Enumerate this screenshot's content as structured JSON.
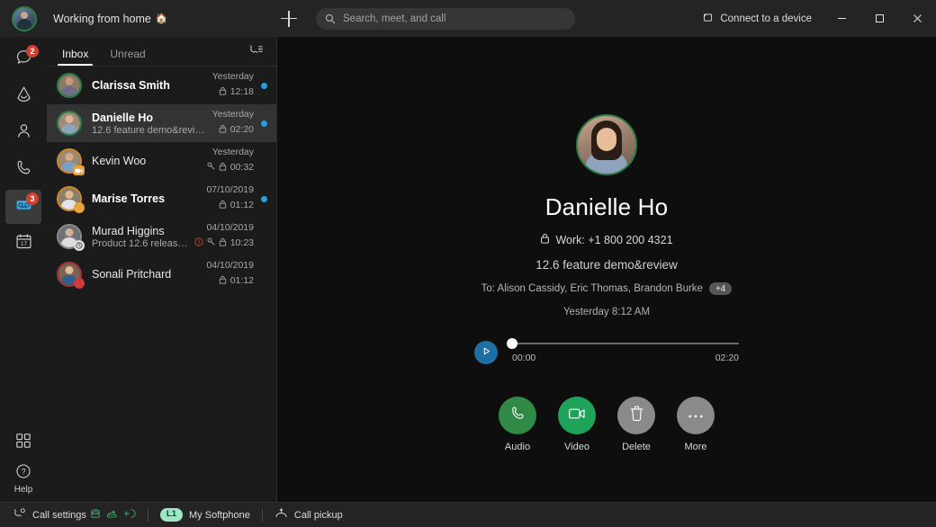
{
  "titlebar": {
    "status_text": "Working from home",
    "status_emoji": "🏠",
    "new_label": "+",
    "connect_device": "Connect to a device",
    "minimize": "─",
    "maximize": "□",
    "close": "✕"
  },
  "search": {
    "placeholder": "Search, meet, and call",
    "value": ""
  },
  "rail": {
    "items": [
      {
        "name": "messaging",
        "badge": "2",
        "active": false
      },
      {
        "name": "teams",
        "badge": "",
        "active": false
      },
      {
        "name": "contacts",
        "badge": "",
        "active": false
      },
      {
        "name": "calls",
        "badge": "",
        "active": false
      },
      {
        "name": "voicemail",
        "badge": "3",
        "active": true
      },
      {
        "name": "calendar",
        "badge": "",
        "active": false,
        "day": "17"
      }
    ],
    "apps_label": "Apps",
    "help_label": "Help"
  },
  "list": {
    "tabs": [
      {
        "label": "Inbox",
        "active": true
      },
      {
        "label": "Unread",
        "active": false
      }
    ],
    "filter_icon": "voicemail-filter-icon",
    "messages": [
      {
        "name": "Clarissa Smith",
        "preview": "",
        "date": "Yesterday",
        "time": "12:18",
        "unread": true,
        "selected": false,
        "locked": true,
        "private": false,
        "urgent": false,
        "presence": "available",
        "ring": "#2d7d46",
        "badge": ""
      },
      {
        "name": "Danielle Ho",
        "preview": "12.6 feature demo&review",
        "date": "Yesterday",
        "time": "02:20",
        "unread": true,
        "selected": true,
        "locked": true,
        "private": false,
        "urgent": false,
        "presence": "available",
        "ring": "#2d7d46",
        "badge": ""
      },
      {
        "name": "Kevin Woo",
        "preview": "",
        "date": "Yesterday",
        "time": "00:32",
        "unread": false,
        "selected": false,
        "locked": true,
        "private": true,
        "urgent": false,
        "presence": "in-a-meeting",
        "ring": "#d08b2a",
        "badge": "#e8a33d"
      },
      {
        "name": "Marise Torres",
        "preview": "",
        "date": "07/10/2019",
        "time": "01:12",
        "unread": true,
        "selected": false,
        "locked": true,
        "private": false,
        "urgent": false,
        "presence": "away",
        "ring": "#d08b2a",
        "badge": "#e8a33d"
      },
      {
        "name": "Murad Higgins",
        "preview": "Product 12.6 release pl...",
        "date": "04/10/2019",
        "time": "10:23",
        "unread": false,
        "selected": false,
        "locked": true,
        "private": true,
        "urgent": true,
        "presence": "offline",
        "ring": "#8b8b8b",
        "badge": "#d8d8d8"
      },
      {
        "name": "Sonali Pritchard",
        "preview": "",
        "date": "04/10/2019",
        "time": "01:12",
        "unread": false,
        "selected": false,
        "locked": true,
        "private": false,
        "urgent": false,
        "presence": "busy",
        "ring": "#a33636",
        "badge": "#cf3b3b"
      }
    ]
  },
  "detail": {
    "name": "Danielle Ho",
    "phone_label": "Work: +1 800 200 4321",
    "subject": "12.6 feature demo&review",
    "to_label": "To: Alison Cassidy, Eric Thomas, Brandon Burke",
    "to_more": "+4",
    "timestamp": "Yesterday 8:12 AM",
    "player": {
      "play_icon": "play-icon",
      "current_time": "00:00",
      "total_time": "02:20",
      "progress_percent": 0
    },
    "actions": [
      {
        "label": "Audio",
        "icon": "phone-icon",
        "color": "#2f8a46"
      },
      {
        "label": "Video",
        "icon": "video-icon",
        "color": "#1fa35b"
      },
      {
        "label": "Delete",
        "icon": "trash-icon",
        "color": "#8a8a8a"
      },
      {
        "label": "More",
        "icon": "ellipsis-icon",
        "color": "#8a8a8a"
      }
    ]
  },
  "statusbar": {
    "call_settings": "Call settings",
    "line_chip": "L1",
    "softphone": "My Softphone",
    "call_pickup": "Call pickup"
  },
  "colors": {
    "accent_blue": "#2a9ddb",
    "unread_dot": "#2a9ddb",
    "badge_red": "#d1402f",
    "green": "#2f8a46",
    "window_bg": "#1b1b1b",
    "detail_bg": "#0e0e0e",
    "titlebar_bg": "#242424"
  }
}
